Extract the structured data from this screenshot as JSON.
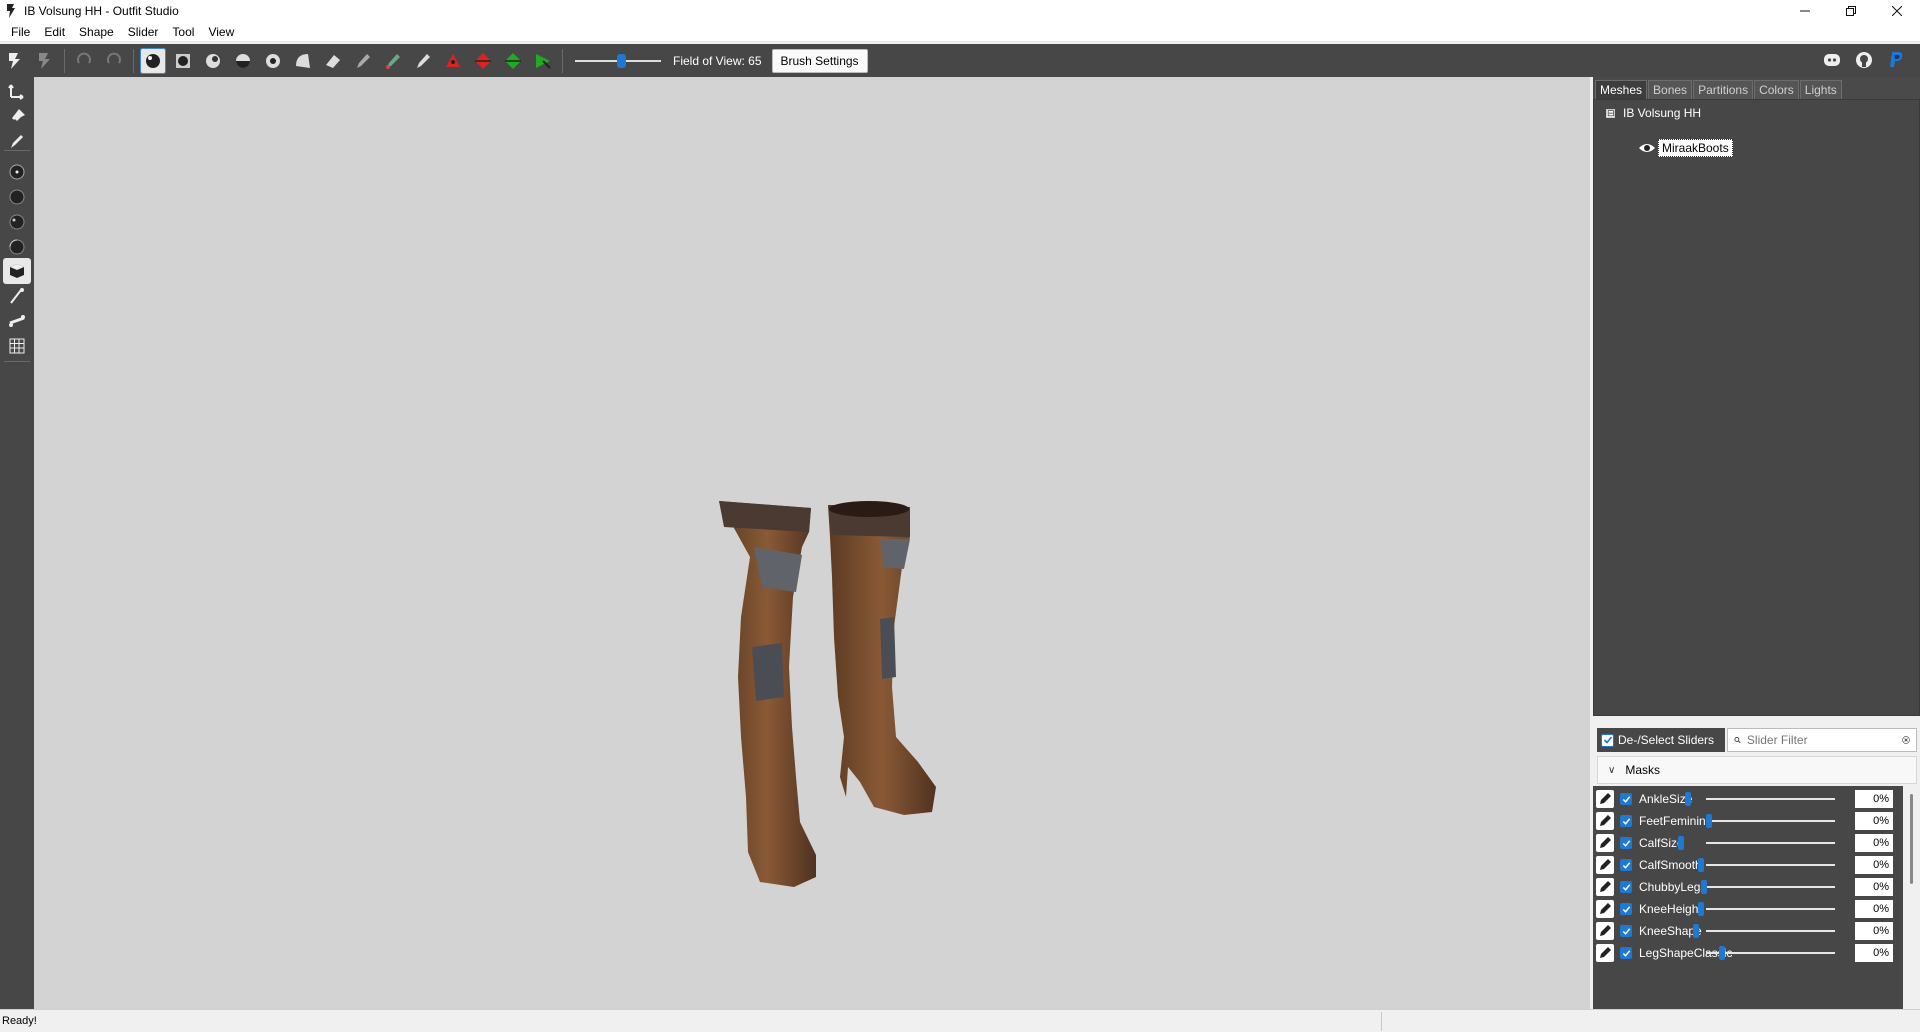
{
  "window": {
    "title": "IB Volsung HH - Outfit Studio",
    "controls": [
      "minimize-icon",
      "restore-icon",
      "close-icon"
    ]
  },
  "menu": [
    "File",
    "Edit",
    "Shape",
    "Slider",
    "Tool",
    "View"
  ],
  "toolbar": {
    "fov_label": "Field of View: 65",
    "fov_value": 65,
    "brush_settings_label": "Brush Settings",
    "right_icons": [
      "discord-icon",
      "github-icon",
      "paypal-icon"
    ]
  },
  "tabs": [
    "Meshes",
    "Bones",
    "Partitions",
    "Colors",
    "Lights"
  ],
  "active_tab": "Meshes",
  "mesh_tree": {
    "root": "IB Volsung HH",
    "root_expander": "⊟",
    "child": "MiraakBoots"
  },
  "slider_panel": {
    "deselect_label": "De-/Select Sliders",
    "filter_placeholder": "Slider Filter",
    "group": "Masks",
    "sliders": [
      {
        "name": "AnkleSize",
        "value": "0%"
      },
      {
        "name": "FeetFeminine",
        "value": "0%"
      },
      {
        "name": "CalfSize",
        "value": "0%"
      },
      {
        "name": "CalfSmooth",
        "value": "0%"
      },
      {
        "name": "ChubbyLegs",
        "value": "0%"
      },
      {
        "name": "KneeHeight",
        "value": "0%"
      },
      {
        "name": "KneeShape",
        "value": "0%"
      },
      {
        "name": "LegShapeClassic",
        "value": "0%"
      }
    ]
  },
  "status": {
    "text": "Ready!"
  },
  "colors": {
    "accent": "#1f78d1",
    "panel_dark": "#474747",
    "viewport": "#d3d3d3"
  }
}
